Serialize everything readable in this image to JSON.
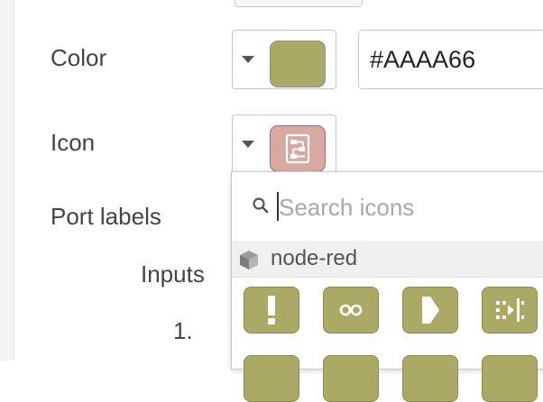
{
  "form": {
    "color": {
      "label": "Color",
      "swatch_color": "#AAAA66",
      "hex_value": "#AAAA66"
    },
    "icon": {
      "label": "Icon",
      "swatch_color": "#D8A9A0",
      "icon_name": "subflow-icon"
    },
    "port_labels": {
      "label": "Port labels",
      "inputs_label": "Inputs",
      "first_index": "1."
    }
  },
  "icon_picker": {
    "search_placeholder": "Search icons",
    "group_name": "node-red",
    "group_icon": "cube-icon",
    "icons": [
      "alert-icon",
      "link-icon",
      "arrow-right-icon",
      "split-icon"
    ],
    "tile_color": "#AAAA66"
  }
}
